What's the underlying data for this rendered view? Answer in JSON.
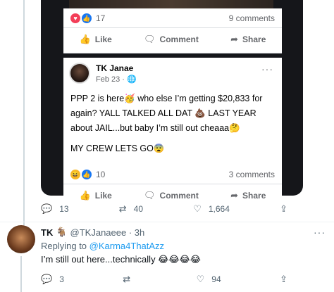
{
  "media": {
    "top_post": {
      "reaction_count": "17",
      "comments": "9 comments",
      "actions": [
        "Like",
        "Comment",
        "Share"
      ]
    },
    "main_post": {
      "author": "TK Janae",
      "date": "Feb 23 · ",
      "more": "···",
      "lines": [
        "PPP 2 is here🥳 who else I’m getting $20,833 for again? YALL TALKED ALL DAT 💩 LAST YEAR about JAIL...but baby I’m still out cheaaa🤔",
        "MY CREW LETS GO😨"
      ],
      "reaction_count": "10",
      "comments": "3 comments",
      "actions": [
        "Like",
        "Comment",
        "Share"
      ]
    }
  },
  "tweet_metrics": {
    "replies": "13",
    "retweets": "40",
    "likes": "1,664"
  },
  "reply": {
    "name": "TK",
    "badge": "🐐",
    "handle": "@TKJanaeee · 3h",
    "more": "···",
    "replying_prefix": "Replying to ",
    "replying_to": "@Karma4ThatAzz",
    "text": "I’m still out here...technically 😂😂😂😂",
    "metrics": {
      "replies": "3",
      "retweets": "",
      "likes": "94"
    }
  },
  "icons": {
    "reply": "speech-bubble-icon",
    "retweet": "retweet-icon",
    "like": "heart-icon",
    "share": "share-icon",
    "fb_like": "thumbs-up-icon",
    "fb_comment": "comment-icon",
    "fb_share": "share-arrow-icon"
  },
  "colors": {
    "twitter_blue": "#1d9bf0",
    "fb_blue": "#1877f2",
    "heart": "#f33e58",
    "muted": "#536471"
  }
}
